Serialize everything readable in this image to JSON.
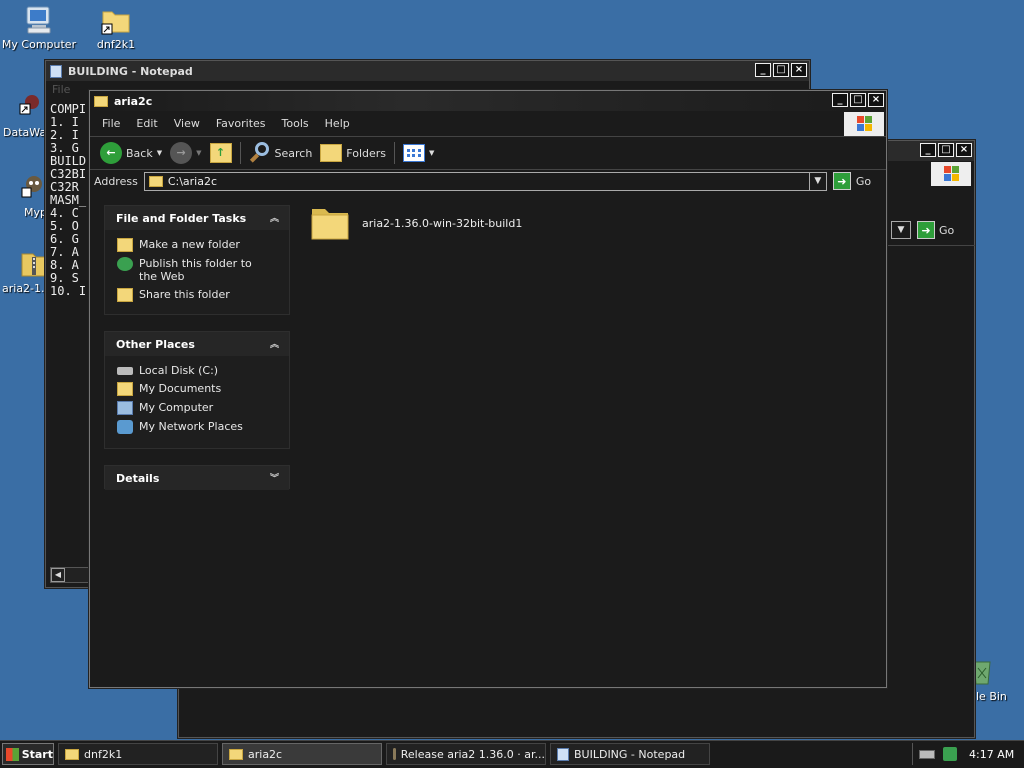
{
  "desktop": {
    "icons": [
      {
        "label": "My Computer"
      },
      {
        "label": "dnf2k1"
      },
      {
        "label": "DataWa"
      },
      {
        "label": "Myp"
      },
      {
        "label": "aria2-1.3"
      },
      {
        "label": "le Bin"
      }
    ]
  },
  "notepad": {
    "title": "BUILDING - Notepad",
    "menu_peek": "File",
    "lines": [
      "COMPI",
      "1. I",
      "2. I",
      "3. G",
      "BUILD",
      "C32BI",
      "C32R",
      "MASM_",
      "4. C",
      "5. O",
      "6. G",
      "7. A",
      "8. A",
      "9. S",
      "10. I"
    ]
  },
  "explorer": {
    "title": "aria2c",
    "menu": [
      "File",
      "Edit",
      "View",
      "Favorites",
      "Tools",
      "Help"
    ],
    "toolbar": {
      "back": "Back",
      "search": "Search",
      "folders": "Folders"
    },
    "address": {
      "label": "Address",
      "value": "C:\\aria2c",
      "go": "Go"
    },
    "tasks": {
      "title": "File and Folder Tasks",
      "items": [
        "Make a new folder",
        "Publish this folder to the Web",
        "Share this folder"
      ]
    },
    "places": {
      "title": "Other Places",
      "items": [
        "Local Disk (C:)",
        "My Documents",
        "My Computer",
        "My Network Places"
      ]
    },
    "details": {
      "title": "Details"
    },
    "files": [
      {
        "name": "aria2-1.36.0-win-32bit-build1"
      }
    ]
  },
  "back_window": {
    "go": "Go"
  },
  "taskbar": {
    "start": "Start",
    "tasks": [
      {
        "label": "dnf2k1",
        "active": false
      },
      {
        "label": "aria2c",
        "active": true
      },
      {
        "label": "Release aria2 1.36.0 · ar...",
        "active": false
      },
      {
        "label": "BUILDING - Notepad",
        "active": false
      }
    ],
    "clock": "4:17 AM"
  },
  "colors": {
    "desktop": "#3a6ea5",
    "window_bg": "#1b1b1b",
    "folder": "#f3d77a",
    "go_green": "#2e9e3a"
  }
}
